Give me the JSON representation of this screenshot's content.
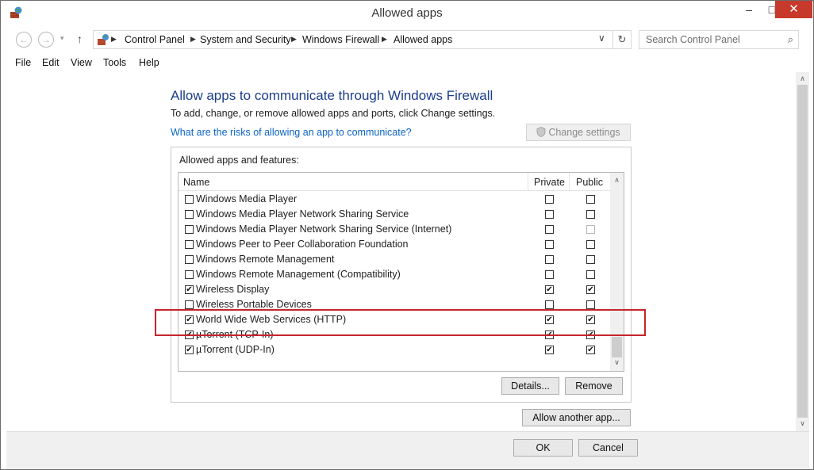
{
  "window": {
    "title": "Allowed apps",
    "minimize": "–",
    "maximize": "□",
    "close": "✕"
  },
  "nav": {
    "back_icon": "←",
    "forward_icon": "→",
    "dropdown_icon": "▾",
    "up_icon": "↑",
    "breadcrumb": [
      "Control Panel",
      "System and Security",
      "Windows Firewall",
      "Allowed apps"
    ],
    "separator": "▶",
    "address_dropdown": "∨",
    "refresh_icon": "↻",
    "search_placeholder": "Search Control Panel",
    "search_icon": "⌕"
  },
  "menu": [
    "File",
    "Edit",
    "View",
    "Tools",
    "Help"
  ],
  "main": {
    "heading": "Allow apps to communicate through Windows Firewall",
    "subtext": "To add, change, or remove allowed apps and ports, click Change settings.",
    "risk_link": "What are the risks of allowing an app to communicate?",
    "change_settings": "Change settings",
    "group_label": "Allowed apps and features:",
    "columns": {
      "name": "Name",
      "private": "Private",
      "public": "Public"
    },
    "apps": [
      {
        "name": "Windows Media Player",
        "enabled": false,
        "private": false,
        "public": false,
        "public_disabled": false
      },
      {
        "name": "Windows Media Player Network Sharing Service",
        "enabled": false,
        "private": false,
        "public": false,
        "public_disabled": false
      },
      {
        "name": "Windows Media Player Network Sharing Service (Internet)",
        "enabled": false,
        "private": false,
        "public": false,
        "public_disabled": true
      },
      {
        "name": "Windows Peer to Peer Collaboration Foundation",
        "enabled": false,
        "private": false,
        "public": false,
        "public_disabled": false
      },
      {
        "name": "Windows Remote Management",
        "enabled": false,
        "private": false,
        "public": false,
        "public_disabled": false
      },
      {
        "name": "Windows Remote Management (Compatibility)",
        "enabled": false,
        "private": false,
        "public": false,
        "public_disabled": false
      },
      {
        "name": "Wireless Display",
        "enabled": true,
        "private": true,
        "public": true,
        "public_disabled": false
      },
      {
        "name": "Wireless Portable Devices",
        "enabled": false,
        "private": false,
        "public": false,
        "public_disabled": false
      },
      {
        "name": "World Wide Web Services (HTTP)",
        "enabled": true,
        "private": true,
        "public": true,
        "public_disabled": false
      },
      {
        "name": "µTorrent (TCP-In)",
        "enabled": true,
        "private": true,
        "public": true,
        "public_disabled": false
      },
      {
        "name": "µTorrent (UDP-In)",
        "enabled": true,
        "private": true,
        "public": true,
        "public_disabled": false
      }
    ],
    "highlighted_app": "World Wide Web Services (HTTP)",
    "details_button": "Details...",
    "remove_button": "Remove",
    "allow_another_button": "Allow another app...",
    "scroll_up": "∧",
    "scroll_down": "∨"
  },
  "footer": {
    "ok": "OK",
    "cancel": "Cancel"
  },
  "colors": {
    "heading": "#1c3d8c",
    "link": "#0b63c5",
    "close": "#c7392a",
    "highlight": "#c5242b"
  }
}
